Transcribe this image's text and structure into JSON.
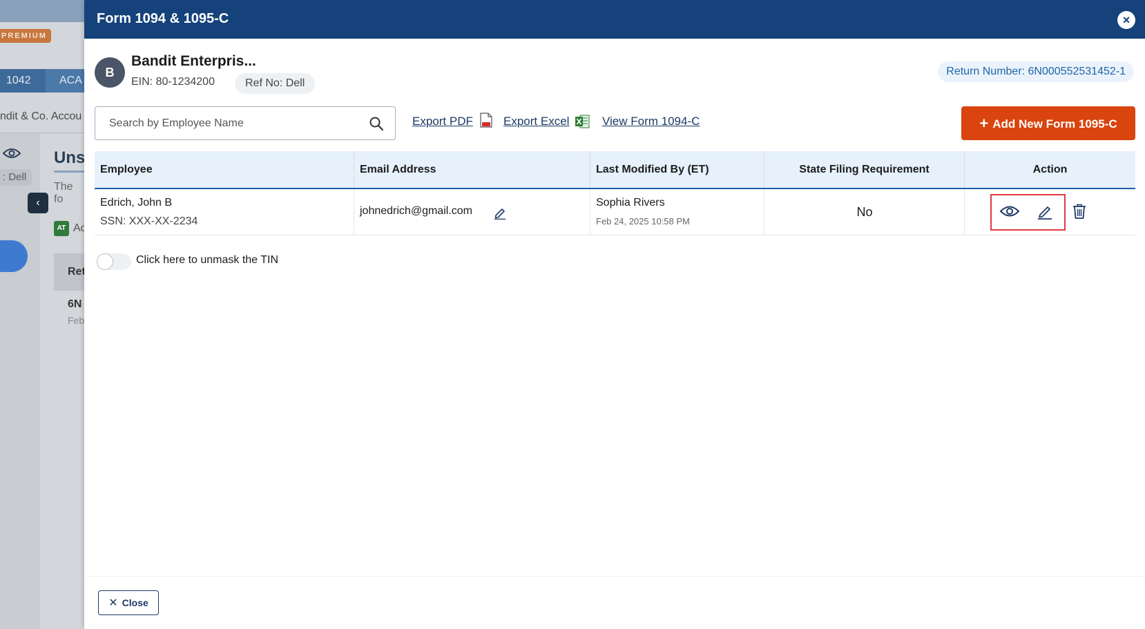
{
  "background": {
    "premium_badge": "PREMIUM",
    "tabs": [
      "1042",
      "ACA"
    ],
    "company_partial": "ndit & Co. Accou",
    "ref_partial": ": Dell",
    "heading_partial": "Uns",
    "desc_partial": "The fo",
    "collapse_glyph": "‹",
    "at_badge": "AT",
    "at_text_partial": "Ac",
    "table_header_partial": "Ret",
    "cell_partial": "6N",
    "cell_date_partial": "Feb"
  },
  "modal": {
    "title": "Form 1094 & 1095-C",
    "close_glyph": "×"
  },
  "company": {
    "avatar_letter": "B",
    "name": "Bandit Enterpris...",
    "ein": "EIN: 80-1234200",
    "ref_no": "Ref No: Dell",
    "return_number": "Return Number: 6N000552531452-1"
  },
  "toolbar": {
    "search_placeholder": "Search by Employee Name",
    "export_pdf": "Export PDF",
    "export_excel": "Export Excel",
    "view_form": "View Form 1094-C",
    "add_plus": "+",
    "add_button": "Add New Form 1095-C"
  },
  "table": {
    "headers": [
      "Employee",
      "Email Address",
      "Last Modified By (ET)",
      "State Filing Requirement",
      "Action"
    ],
    "rows": [
      {
        "employee_name": "Edrich, John B",
        "ssn": "SSN: XXX-XX-2234",
        "email": "johnedrich@gmail.com",
        "modified_by": "Sophia Rivers",
        "modified_date": "Feb 24, 2025 10:58 PM",
        "state_filing": "No"
      }
    ]
  },
  "unmask": {
    "label": "Click here to unmask the TIN",
    "enabled": false
  },
  "footer": {
    "close_glyph": "✕",
    "close_label": "Close"
  },
  "colors": {
    "header_bg": "#15427a",
    "accent_orange": "#d9440f",
    "table_head_bg": "#e6f1fc",
    "highlight_red": "#e0393f"
  }
}
